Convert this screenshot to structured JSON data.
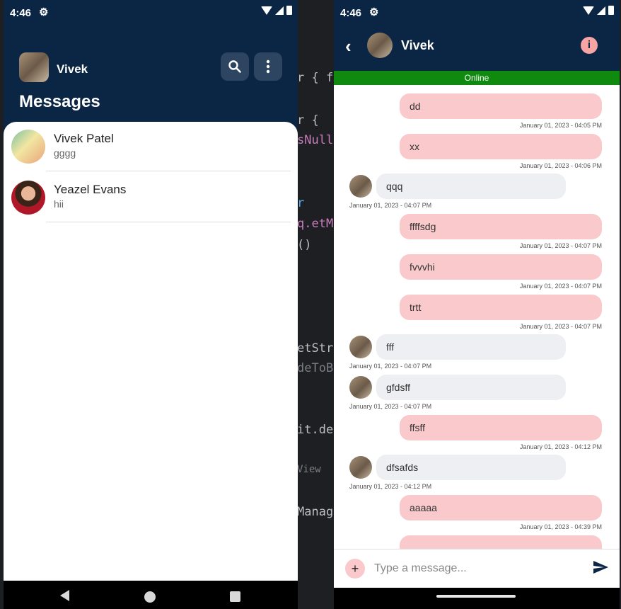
{
  "left_phone": {
    "status_time": "4:46",
    "header": {
      "name": "Vivek",
      "title": "Messages"
    },
    "conversations": [
      {
        "name": "Vivek Patel",
        "last_message": "gggg"
      },
      {
        "name": "Yeazel Evans",
        "last_message": "hii"
      }
    ]
  },
  "right_phone": {
    "status_time": "4:46",
    "header": {
      "name": "Vivek"
    },
    "online_label": "Online",
    "messages": [
      {
        "dir": "out",
        "text": "dd",
        "time": "January 01, 2023 - 04:05 PM"
      },
      {
        "dir": "out",
        "text": "xx",
        "time": "January 01, 2023 - 04:06 PM"
      },
      {
        "dir": "in",
        "text": "qqq",
        "time": "January 01, 2023 - 04:07 PM"
      },
      {
        "dir": "out",
        "text": "ffffsdg",
        "time": "January 01, 2023 - 04:07 PM"
      },
      {
        "dir": "out",
        "text": "fvvvhi",
        "time": "January 01, 2023 - 04:07 PM"
      },
      {
        "dir": "out",
        "text": "trtt",
        "time": "January 01, 2023 - 04:07 PM"
      },
      {
        "dir": "in",
        "text": "fff",
        "time": "January 01, 2023 - 04:07 PM"
      },
      {
        "dir": "in",
        "text": "gfdsff",
        "time": "January 01, 2023 - 04:07 PM"
      },
      {
        "dir": "out",
        "text": "ffsff",
        "time": "January 01, 2023 - 04:12 PM"
      },
      {
        "dir": "in",
        "text": "dfsafds",
        "time": "January 01, 2023 - 04:12 PM"
      },
      {
        "dir": "out",
        "text": "aaaaa",
        "time": "January 01, 2023 - 04:39 PM"
      }
    ],
    "composer": {
      "placeholder": "Type a message..."
    }
  },
  "background_code": [
    "r { f",
    "r {",
    "sNull",
    "r",
    "q.etM",
    "()",
    "etStr",
    "deToB",
    "it.de",
    "View",
    "Manag"
  ],
  "colors": {
    "header_bg": "#0b2545",
    "outgoing_bubble": "#f9c9cb",
    "incoming_bubble": "#eeeff2",
    "online_bar": "#0f8a0f"
  }
}
